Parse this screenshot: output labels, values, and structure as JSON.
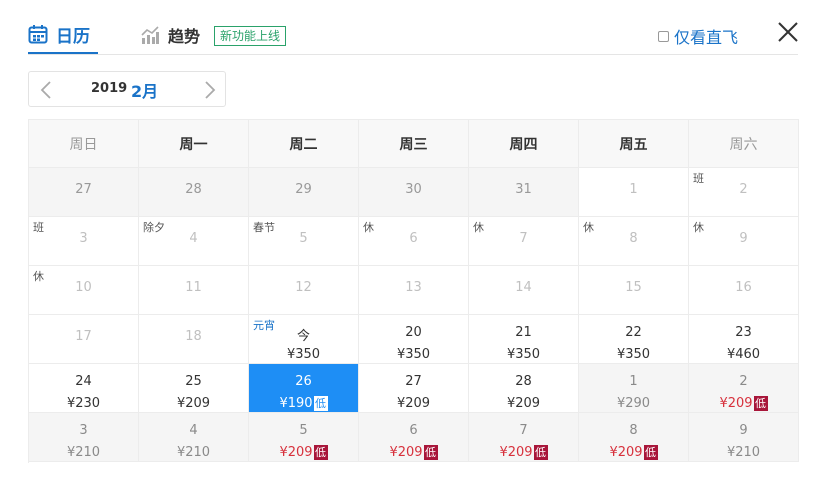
{
  "header": {
    "tab_calendar": "日历",
    "tab_trend": "趋势",
    "new_badge": "新功能上线",
    "direct_only": "仅看直飞"
  },
  "month_bar": {
    "year": "2019",
    "month": "2月"
  },
  "weekdays": [
    "周日",
    "周一",
    "周二",
    "周三",
    "周四",
    "周五",
    "周六"
  ],
  "weeks": [
    [
      {
        "day": "27",
        "style": "past",
        "bg": "gray"
      },
      {
        "day": "28",
        "style": "past",
        "bg": "gray"
      },
      {
        "day": "29",
        "style": "past",
        "bg": "gray"
      },
      {
        "day": "30",
        "style": "past",
        "bg": "gray"
      },
      {
        "day": "31",
        "style": "past",
        "bg": "gray"
      },
      {
        "day": "1",
        "style": "faint",
        "bg": "white"
      },
      {
        "day": "2",
        "style": "faint",
        "bg": "white",
        "tag": "班"
      }
    ],
    [
      {
        "day": "3",
        "style": "faint",
        "bg": "white",
        "tag": "班"
      },
      {
        "day": "4",
        "style": "faint",
        "bg": "white",
        "tag": "除夕"
      },
      {
        "day": "5",
        "style": "faint",
        "bg": "white",
        "tag": "春节"
      },
      {
        "day": "6",
        "style": "faint",
        "bg": "white",
        "tag": "休"
      },
      {
        "day": "7",
        "style": "faint",
        "bg": "white",
        "tag": "休"
      },
      {
        "day": "8",
        "style": "faint",
        "bg": "white",
        "tag": "休"
      },
      {
        "day": "9",
        "style": "faint",
        "bg": "white",
        "tag": "休"
      }
    ],
    [
      {
        "day": "10",
        "style": "faint",
        "bg": "white",
        "tag": "休"
      },
      {
        "day": "11",
        "style": "faint",
        "bg": "white"
      },
      {
        "day": "12",
        "style": "faint",
        "bg": "white"
      },
      {
        "day": "13",
        "style": "faint",
        "bg": "white"
      },
      {
        "day": "14",
        "style": "faint",
        "bg": "white"
      },
      {
        "day": "15",
        "style": "faint",
        "bg": "white"
      },
      {
        "day": "16",
        "style": "faint",
        "bg": "white"
      }
    ],
    [
      {
        "day": "17",
        "style": "faint",
        "bg": "white"
      },
      {
        "day": "18",
        "style": "faint",
        "bg": "white"
      },
      {
        "day": "今",
        "style": "normal",
        "bg": "white",
        "tag": "元宵",
        "tag_color": "blue",
        "price": "¥350"
      },
      {
        "day": "20",
        "style": "normal",
        "bg": "white",
        "price": "¥350"
      },
      {
        "day": "21",
        "style": "normal",
        "bg": "white",
        "price": "¥350"
      },
      {
        "day": "22",
        "style": "normal",
        "bg": "white",
        "price": "¥350"
      },
      {
        "day": "23",
        "style": "normal",
        "bg": "white",
        "price": "¥460"
      }
    ],
    [
      {
        "day": "24",
        "style": "normal",
        "bg": "white",
        "price": "¥230"
      },
      {
        "day": "25",
        "style": "normal",
        "bg": "white",
        "price": "¥209"
      },
      {
        "day": "26",
        "style": "selected",
        "bg": "selected",
        "price": "¥190",
        "low": "低"
      },
      {
        "day": "27",
        "style": "normal",
        "bg": "white",
        "price": "¥209"
      },
      {
        "day": "28",
        "style": "normal",
        "bg": "white",
        "price": "¥209"
      },
      {
        "day": "1",
        "style": "mute",
        "bg": "gray",
        "price": "¥290"
      },
      {
        "day": "2",
        "style": "mute",
        "bg": "gray",
        "price": "¥209",
        "low": "低"
      }
    ],
    [
      {
        "day": "3",
        "style": "mute",
        "bg": "gray",
        "price": "¥210"
      },
      {
        "day": "4",
        "style": "mute",
        "bg": "gray",
        "price": "¥210"
      },
      {
        "day": "5",
        "style": "mute",
        "bg": "gray",
        "price": "¥209",
        "low": "低"
      },
      {
        "day": "6",
        "style": "mute",
        "bg": "gray",
        "price": "¥209",
        "low": "低"
      },
      {
        "day": "7",
        "style": "mute",
        "bg": "gray",
        "price": "¥209",
        "low": "低"
      },
      {
        "day": "8",
        "style": "mute",
        "bg": "gray",
        "price": "¥209",
        "low": "低"
      },
      {
        "day": "9",
        "style": "mute",
        "bg": "gray",
        "price": "¥210"
      }
    ]
  ],
  "colors": {
    "accent": "#1a73c8",
    "selected_bg": "#1e8ef5",
    "low_price": "#d7303c",
    "low_badge": "#a8163a",
    "new_badge": "#2aa26a"
  }
}
